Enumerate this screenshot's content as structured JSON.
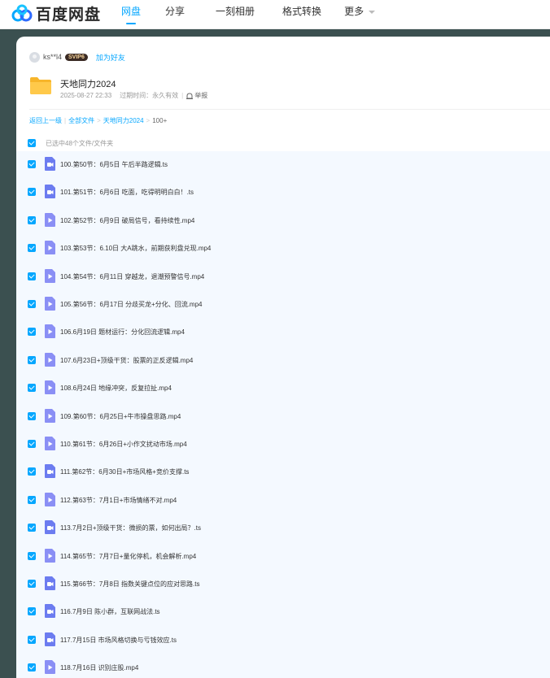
{
  "app": {
    "logo_text": "百度网盘",
    "accent_color": "#06a7ff"
  },
  "nav": [
    {
      "label": "网盘",
      "active": true
    },
    {
      "label": "分享",
      "active": false
    },
    {
      "label": "一刻相册",
      "active": false
    },
    {
      "label": "格式转换",
      "active": false
    },
    {
      "label": "更多",
      "active": false
    }
  ],
  "share": {
    "username": "ks**l4",
    "level_badge": "SVIP6",
    "add_friend": "加为好友",
    "folder_name": "天地同力2024",
    "share_time": "2025-08-27 22:33",
    "expire_text": "过期时间：永久有效",
    "report": "举报"
  },
  "breadcrumb": {
    "back": "返回上一级",
    "all_files": "全部文件",
    "folder": "天地同力2024",
    "current": "100+"
  },
  "selection": {
    "text": "已选中48个文件/文件夹"
  },
  "files": [
    {
      "name": "100.第50节：6月5日 午后半路逻辑.ts",
      "icon": "video-file-icon"
    },
    {
      "name": "101.第51节：6月6日 吃面，吃得明明白白！.ts",
      "icon": "video-file-icon"
    },
    {
      "name": "102.第52节：6月9日 破局信号，看持续性.mp4",
      "icon": "mp4-file-icon"
    },
    {
      "name": "103.第53节：6.10日 大A跳水，前期获利盘兑现.mp4",
      "icon": "mp4-file-icon"
    },
    {
      "name": "104.第54节：6月11日 穿越龙，退潮预警信号.mp4",
      "icon": "mp4-file-icon"
    },
    {
      "name": "105.第56节：6月17日 分歧买龙+分化、回流.mp4",
      "icon": "mp4-file-icon"
    },
    {
      "name": "106.6月19日 题材运行：分化回流逻辑.mp4",
      "icon": "mp4-file-icon"
    },
    {
      "name": "107.6月23日+顶级干货：股票的正反逻辑.mp4",
      "icon": "mp4-file-icon"
    },
    {
      "name": "108.6月24日 地缘冲突，反复拉扯.mp4",
      "icon": "mp4-file-icon"
    },
    {
      "name": "109.第60节：6月25日+牛市操盘思路.mp4",
      "icon": "mp4-file-icon"
    },
    {
      "name": "110.第61节：6月26日+小作文扰动市场.mp4",
      "icon": "mp4-file-icon"
    },
    {
      "name": "111.第62节：6月30日+市场风格+竞价支撑.ts",
      "icon": "video-file-icon"
    },
    {
      "name": "112.第63节：7月1日+市场情绪不对.mp4",
      "icon": "mp4-file-icon"
    },
    {
      "name": "113.7月2日+顶级干货：微损的票，如何出局？.ts",
      "icon": "video-file-icon"
    },
    {
      "name": "114.第65节：7月7日+量化停机，机会解析.mp4",
      "icon": "mp4-file-icon"
    },
    {
      "name": "115.第66节：7月8日 指数关键点位的应对思路.ts",
      "icon": "video-file-icon"
    },
    {
      "name": "116.7月9日 陈小群，互联网战法.ts",
      "icon": "video-file-icon"
    },
    {
      "name": "117.7月15日 市场风格切换与亏钱效应.ts",
      "icon": "video-file-icon"
    },
    {
      "name": "118.7月16日 识别庄股.mp4",
      "icon": "mp4-file-icon"
    }
  ]
}
